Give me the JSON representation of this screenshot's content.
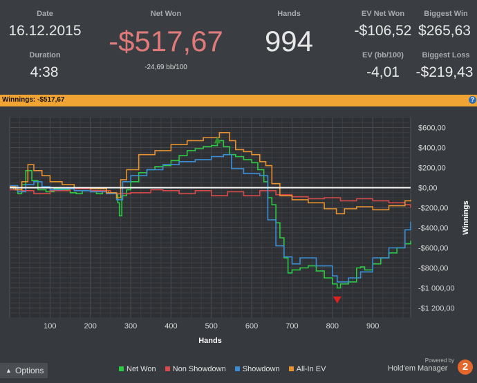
{
  "stats": {
    "date_label": "Date",
    "date_value": "16.12.2015",
    "duration_label": "Duration",
    "duration_value": "4:38",
    "net_won_label": "Net Won",
    "net_won_value": "-$517,67",
    "bb_per_100": "-24,69 bb/100",
    "hands_label": "Hands",
    "hands_value": "994",
    "ev_net_won_label": "EV Net Won",
    "ev_net_won_value": "-$106,52",
    "ev_bb100_label": "EV (bb/100)",
    "ev_bb100_value": "-4,01",
    "biggest_win_label": "Biggest Win",
    "biggest_win_value": "$265,63",
    "biggest_loss_label": "Biggest Loss",
    "biggest_loss_value": "-$219,43"
  },
  "winnings_bar": {
    "text": "Winnings: -$517,67",
    "help_icon": "?"
  },
  "colors": {
    "net_won": "#2dcb44",
    "non_showdown": "#d84a4a",
    "showdown": "#3b8ed6",
    "all_in_ev": "#e8912f",
    "accent_bar": "#efa434",
    "negative_value": "#e07a7a"
  },
  "options": {
    "label": "Options",
    "icon": "caret-up-icon"
  },
  "branding": {
    "powered_by": "Powered by",
    "name": "Hold'em Manager",
    "logo_text": "2"
  },
  "chart_data": {
    "type": "line",
    "xlabel": "Hands",
    "ylabel": "Winnings",
    "xlim": [
      0,
      994
    ],
    "ylim": [
      -1300,
      700
    ],
    "x_ticks": [
      100,
      200,
      300,
      400,
      500,
      600,
      700,
      800,
      900
    ],
    "y_ticks": [
      600,
      400,
      200,
      0,
      -200,
      -400,
      -600,
      -800,
      -1000,
      -1200
    ],
    "y_tick_labels": [
      "$600,00",
      "$400,00",
      "$200,00",
      "$0,00",
      "-$200,00",
      "-$400,00",
      "-$600,00",
      "-$800,00",
      "-$1 000,00",
      "-$1 200,00"
    ],
    "grid": true,
    "legend_placement": "bottom",
    "zero_line": true,
    "markers": [
      {
        "type": "max",
        "x": 515,
        "y": 470
      },
      {
        "type": "min",
        "x": 812,
        "y": 1120
      }
    ],
    "series": [
      {
        "name": "Net Won",
        "color": "#2dcb44",
        "x": [
          0,
          10,
          20,
          30,
          40,
          55,
          70,
          90,
          110,
          130,
          150,
          165,
          180,
          200,
          215,
          230,
          245,
          255,
          263,
          268,
          272,
          278,
          290,
          300,
          320,
          340,
          360,
          380,
          400,
          420,
          440,
          460,
          480,
          500,
          515,
          530,
          545,
          560,
          580,
          600,
          615,
          630,
          640,
          650,
          660,
          670,
          680,
          690,
          700,
          720,
          740,
          760,
          780,
          800,
          812,
          820,
          840,
          860,
          870,
          880,
          900,
          920,
          940,
          960,
          980,
          994
        ],
        "y": [
          10,
          -20,
          -60,
          30,
          170,
          70,
          -20,
          -40,
          -10,
          -20,
          -50,
          -60,
          -30,
          -40,
          -60,
          -30,
          -50,
          -60,
          -60,
          -150,
          -280,
          -80,
          -20,
          60,
          150,
          180,
          210,
          220,
          270,
          320,
          370,
          390,
          410,
          420,
          470,
          410,
          330,
          310,
          280,
          250,
          180,
          60,
          -100,
          -170,
          -350,
          -500,
          -700,
          -850,
          -820,
          -800,
          -780,
          -830,
          -900,
          -960,
          -1000,
          -960,
          -940,
          -800,
          -790,
          -820,
          -760,
          -700,
          -650,
          -600,
          -560,
          -530
        ]
      },
      {
        "name": "Non Showdown",
        "color": "#d84a4a",
        "x": [
          0,
          30,
          60,
          100,
          150,
          200,
          250,
          300,
          350,
          380,
          420,
          460,
          500,
          540,
          580,
          620,
          660,
          700,
          740,
          780,
          820,
          860,
          900,
          940,
          980,
          994
        ],
        "y": [
          -20,
          -30,
          -60,
          -30,
          -10,
          -30,
          -60,
          -50,
          -20,
          -30,
          -60,
          -30,
          -80,
          -40,
          -80,
          -30,
          -70,
          -90,
          -110,
          -100,
          -130,
          -110,
          -130,
          -150,
          -170,
          -200
        ]
      },
      {
        "name": "Showdown",
        "color": "#3b8ed6",
        "x": [
          0,
          20,
          40,
          60,
          80,
          100,
          130,
          160,
          200,
          240,
          265,
          280,
          300,
          340,
          380,
          420,
          460,
          500,
          530,
          550,
          580,
          620,
          640,
          660,
          680,
          700,
          720,
          760,
          800,
          812,
          840,
          870,
          900,
          940,
          980,
          994
        ],
        "y": [
          20,
          -40,
          30,
          60,
          10,
          -20,
          -10,
          -30,
          -40,
          -60,
          -120,
          60,
          120,
          180,
          230,
          260,
          280,
          310,
          330,
          190,
          140,
          120,
          -320,
          -580,
          -690,
          -760,
          -700,
          -780,
          -880,
          -940,
          -900,
          -840,
          -700,
          -600,
          -420,
          -340
        ]
      },
      {
        "name": "All-In EV",
        "color": "#e8912f",
        "x": [
          0,
          15,
          30,
          45,
          60,
          80,
          100,
          130,
          160,
          200,
          240,
          265,
          275,
          290,
          320,
          360,
          400,
          440,
          480,
          520,
          545,
          560,
          580,
          600,
          620,
          635,
          650,
          670,
          700,
          740,
          780,
          810,
          830,
          860,
          900,
          940,
          980,
          994
        ],
        "y": [
          10,
          -20,
          60,
          230,
          170,
          120,
          60,
          30,
          0,
          -10,
          -50,
          -100,
          80,
          180,
          330,
          370,
          430,
          470,
          500,
          550,
          470,
          380,
          360,
          330,
          260,
          220,
          40,
          -80,
          -120,
          -150,
          -210,
          -260,
          -210,
          -190,
          -220,
          -180,
          -130,
          -120
        ]
      }
    ]
  }
}
